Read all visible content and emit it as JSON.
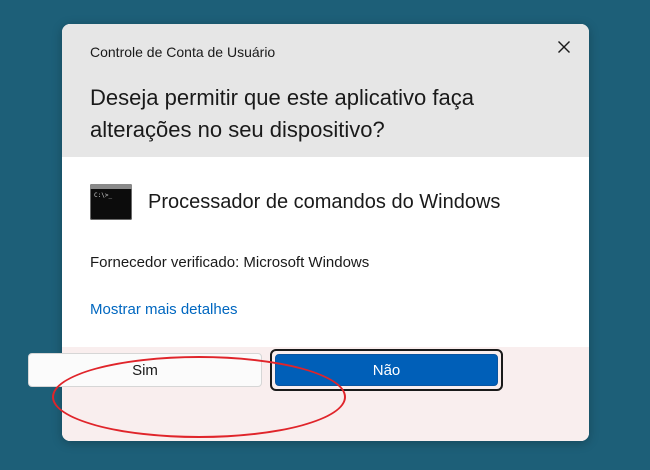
{
  "dialog": {
    "title": "Controle de Conta de Usuário",
    "question": "Deseja permitir que este aplicativo faça alterações no seu dispositivo?",
    "app_name": "Processador de comandos do Windows",
    "app_icon": "command-prompt-icon",
    "publisher": "Fornecedor verificado: Microsoft Windows",
    "details_link": "Mostrar mais detalhes",
    "buttons": {
      "yes_label": "Sim",
      "no_label": "Não"
    }
  },
  "icons": {
    "close": "close-icon",
    "cmd": "command-prompt-icon"
  },
  "colors": {
    "desktop_background": "#1d5f78",
    "header_background": "#e6e6e6",
    "footer_background": "#f9eeee",
    "link": "#0067c0",
    "primary_button": "#005fb8",
    "annotation": "#e0242a"
  }
}
